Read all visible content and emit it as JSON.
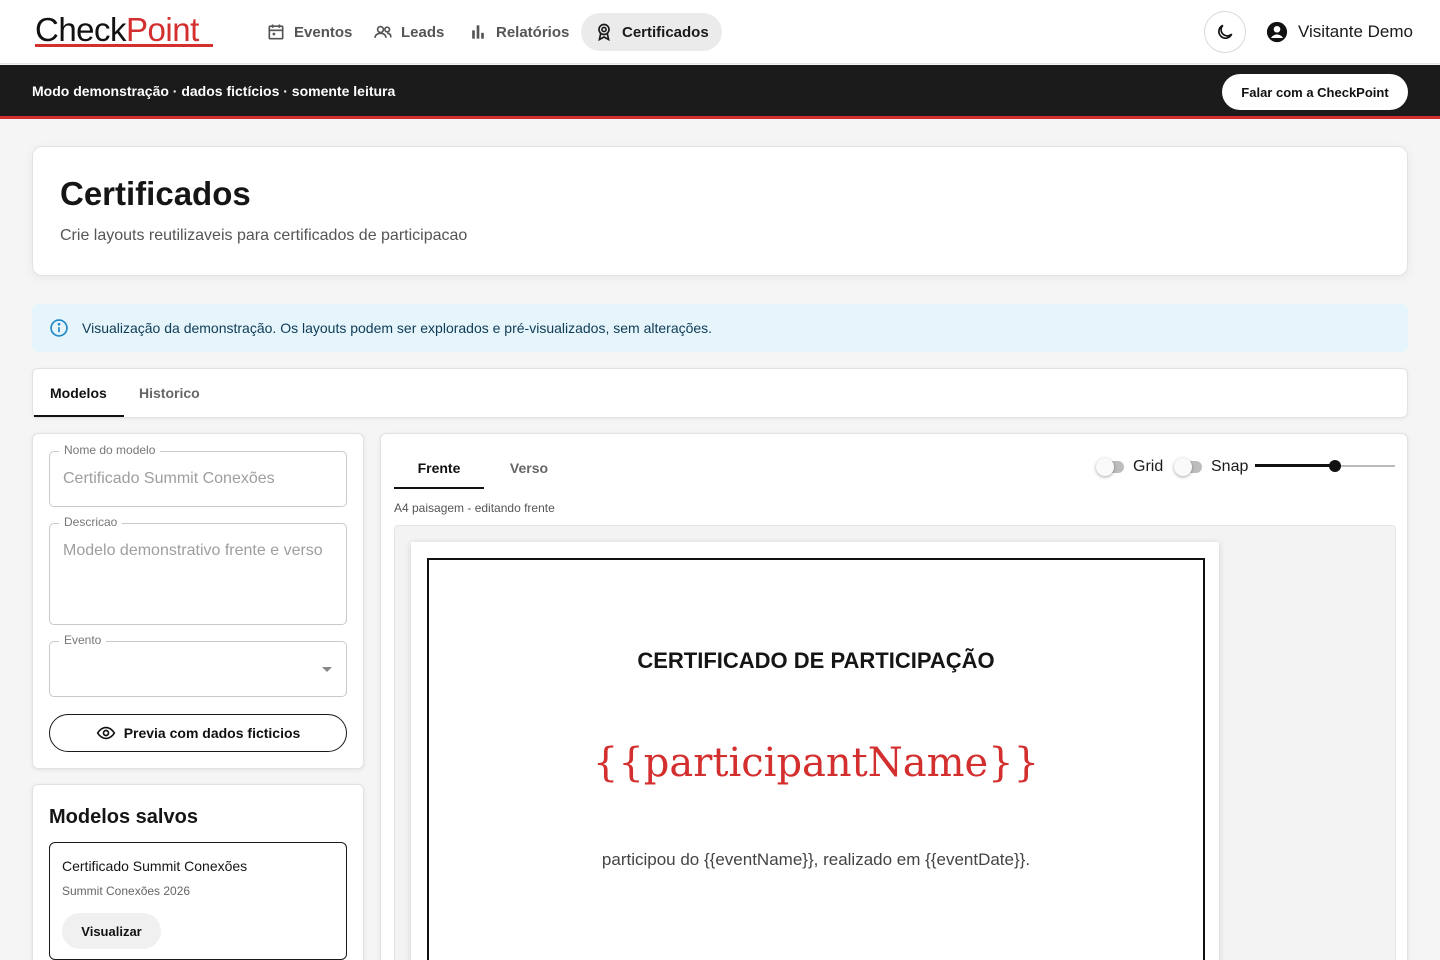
{
  "app": {
    "logo_left": "Check",
    "logo_right": "Point",
    "brand_color": "#d32f2f"
  },
  "nav": {
    "items": [
      {
        "label": "Eventos",
        "icon": "calendar-icon",
        "active": false
      },
      {
        "label": "Leads",
        "icon": "people-icon",
        "active": false
      },
      {
        "label": "Relatórios",
        "icon": "bar-chart-icon",
        "active": false
      },
      {
        "label": "Certificados",
        "icon": "award-icon",
        "active": true
      }
    ],
    "theme_icon": "moon-icon",
    "user_name": "Visitante Demo",
    "user_icon": "account-circle-icon"
  },
  "demo_bar": {
    "text": "Modo demonstração · dados fictícios · somente leitura",
    "button_label": "Falar com a CheckPoint"
  },
  "header": {
    "title": "Certificados",
    "subtitle": "Crie layouts reutilizaveis para certificados de participacao"
  },
  "alert": {
    "icon": "info-icon",
    "text": "Visualização da demonstração. Os layouts podem ser explorados e pré-visualizados, sem alterações.",
    "background": "#e6f4fb"
  },
  "tabs": [
    {
      "label": "Modelos",
      "active": true
    },
    {
      "label": "Historico",
      "active": false
    }
  ],
  "form": {
    "name_label": "Nome do modelo",
    "name_value": "Certificado Summit Conexões",
    "description_label": "Descricao",
    "description_value": "Modelo demonstrativo frente e verso",
    "event_label": "Evento",
    "event_value": "",
    "preview_button": "Previa com dados ficticios",
    "preview_icon": "eye-icon"
  },
  "saved_models": {
    "title": "Modelos salvos",
    "items": [
      {
        "name": "Certificado Summit Conexões",
        "event": "Summit Conexões 2026",
        "button": "Visualizar"
      }
    ]
  },
  "editor": {
    "tabs": [
      {
        "label": "Frente",
        "active": true
      },
      {
        "label": "Verso",
        "active": false
      }
    ],
    "grid_label": "Grid",
    "grid_on": false,
    "snap_label": "Snap",
    "snap_on": false,
    "zoom_fraction": 0.57,
    "caption": "A4 paisagem - editando frente"
  },
  "certificate": {
    "title": "CERTIFICADO DE PARTICIPAÇÃO",
    "name_placeholder": "{{participantName}}",
    "body": "participou do {{eventName}}, realizado em {{eventDate}}."
  }
}
